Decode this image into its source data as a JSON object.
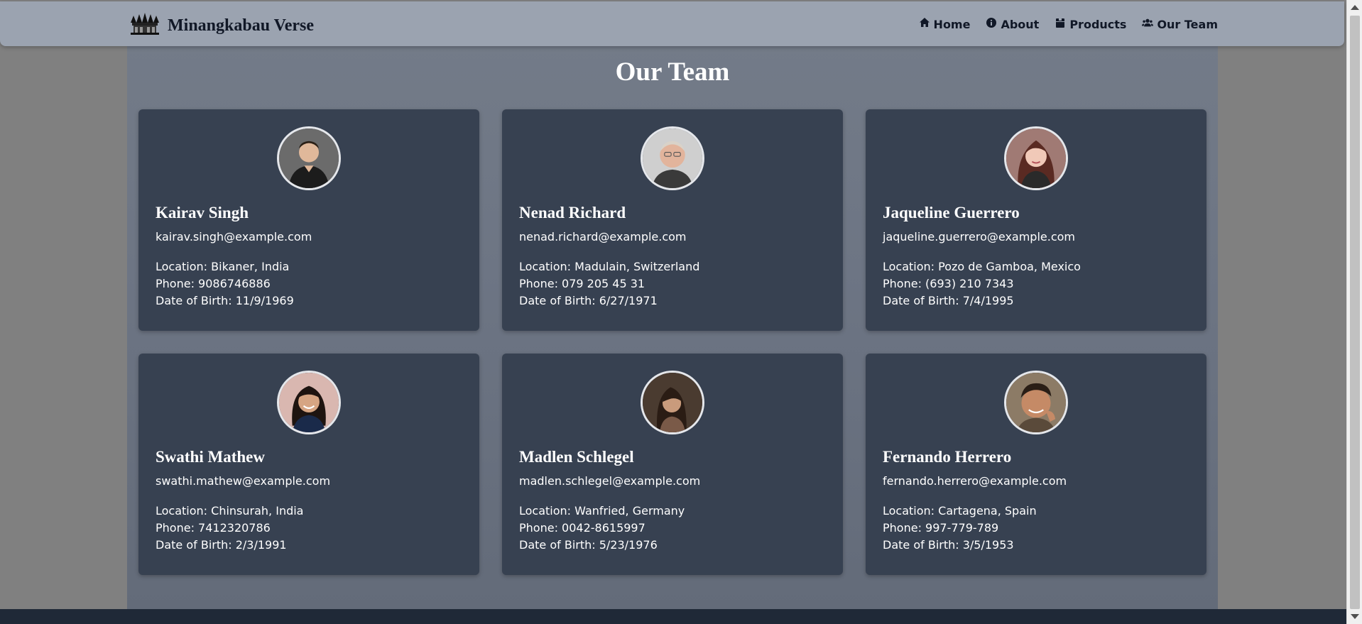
{
  "brand": {
    "name": "Minangkabau Verse",
    "logo_icon": "rumah-gadang-logo"
  },
  "nav": {
    "items": [
      {
        "label": "Home",
        "icon": "home-icon"
      },
      {
        "label": "About",
        "icon": "info-icon"
      },
      {
        "label": "Products",
        "icon": "box-icon"
      },
      {
        "label": "Our Team",
        "icon": "users-icon"
      }
    ]
  },
  "page": {
    "title": "Our Team"
  },
  "colors": {
    "navbar": "#9ba3b0",
    "card": "#374151",
    "content_gradient_top": "#737b88",
    "footer": "#1f2937"
  },
  "team": [
    {
      "name": "Kairav Singh",
      "email": "kairav.singh@example.com",
      "location": "Location: Bikaner, India",
      "phone": "Phone: 9086746886",
      "dob": "Date of Birth: 11/9/1969",
      "avatar": "man-portrait"
    },
    {
      "name": "Nenad Richard",
      "email": "nenad.richard@example.com",
      "location": "Location: Madulain, Switzerland",
      "phone": "Phone: 079 205 45 31",
      "dob": "Date of Birth: 6/27/1971",
      "avatar": "older-man-glasses-portrait"
    },
    {
      "name": "Jaqueline Guerrero",
      "email": "jaqueline.guerrero@example.com",
      "location": "Location: Pozo de Gamboa, Mexico",
      "phone": "Phone: (693) 210 7343",
      "dob": "Date of Birth: 7/4/1995",
      "avatar": "woman-portrait"
    },
    {
      "name": "Swathi Mathew",
      "email": "swathi.mathew@example.com",
      "location": "Location: Chinsurah, India",
      "phone": "Phone: 7412320786",
      "dob": "Date of Birth: 2/3/1991",
      "avatar": "woman-portrait"
    },
    {
      "name": "Madlen Schlegel",
      "email": "madlen.schlegel@example.com",
      "location": "Location: Wanfried, Germany",
      "phone": "Phone: 0042-8615997",
      "dob": "Date of Birth: 5/23/1976",
      "avatar": "woman-portrait"
    },
    {
      "name": "Fernando Herrero",
      "email": "fernando.herrero@example.com",
      "location": "Location: Cartagena, Spain",
      "phone": "Phone: 997-779-789",
      "dob": "Date of Birth: 3/5/1953",
      "avatar": "man-portrait"
    }
  ]
}
